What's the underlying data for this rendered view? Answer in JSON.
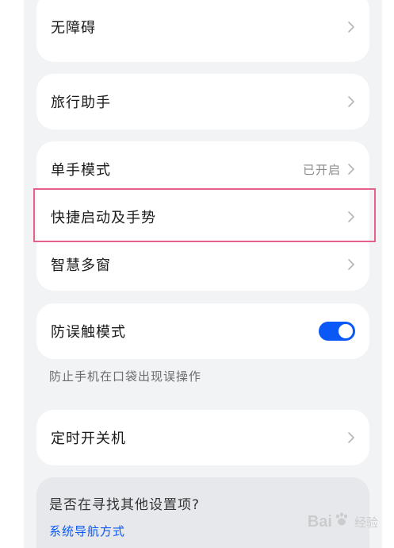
{
  "settings": {
    "accessibility": {
      "label": "无障碍"
    },
    "travel_assistant": {
      "label": "旅行助手"
    },
    "one_hand_mode": {
      "label": "单手模式",
      "value": "已开启"
    },
    "quick_launch_gestures": {
      "label": "快捷启动及手势"
    },
    "smart_multi_window": {
      "label": "智慧多窗"
    },
    "accidental_touch": {
      "label": "防误触模式",
      "enabled": true,
      "description": "防止手机在口袋出现误操作"
    },
    "scheduled_power": {
      "label": "定时开关机"
    }
  },
  "hint": {
    "title": "是否在寻找其他设置项?",
    "link": "系统导航方式"
  },
  "watermark": {
    "brand_left": "Bai",
    "brand_right": "经验",
    "icon": "baidu-paw-icon"
  },
  "colors": {
    "accent": "#0a59f7",
    "highlight_box": "#e4628a",
    "background": "#f1f3f5"
  }
}
